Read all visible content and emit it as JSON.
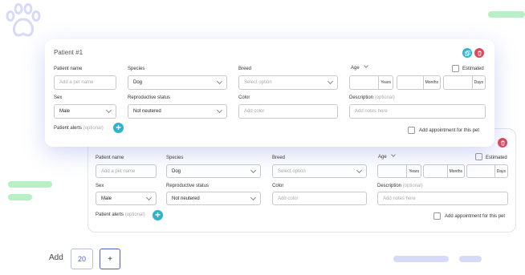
{
  "colors": {
    "brand_blue": "#4f5fc6",
    "teal": "#2fb2cf",
    "delete_red": "#e0485a",
    "deco_green": "#b6f0c4",
    "deco_lavender": "#d6daf8"
  },
  "icons": {
    "paw": "paw-icon",
    "copy": "copy-icon",
    "delete": "trash-icon",
    "add": "plus-icon",
    "dropdown": "chevron-down-icon"
  },
  "patient_card": {
    "title": "Patient #1",
    "labels": {
      "patient_name": "Patient name",
      "species": "Species",
      "breed": "Breed",
      "age": "Age",
      "estimated": "Estimated",
      "sex": "Sex",
      "reproductive_status": "Reproductive status",
      "color": "Color",
      "description": "Description",
      "description_optional": "(optional)",
      "patient_alerts": "Patient alerts",
      "patient_alerts_optional": "(optional)",
      "add_appointment": "Add appointment for this pet"
    },
    "fields": {
      "patient_name_placeholder": "Add a pet name",
      "species_value": "Dog",
      "breed_placeholder": "Select option",
      "age_years_unit": "Years",
      "age_months_unit": "Months",
      "age_days_unit": "Days",
      "sex_value": "Male",
      "reproductive_status_value": "Not neutered",
      "color_placeholder": "Add color",
      "description_placeholder": "Add notes here"
    }
  },
  "background_card": {
    "labels": {
      "patient_name": "Patient name",
      "species": "Species",
      "breed": "Breed",
      "age": "Age",
      "estimated": "Estimated",
      "sex": "Sex",
      "reproductive_status": "Reproductive status",
      "color": "Color",
      "description": "Description",
      "description_optional": "(optional)",
      "patient_alerts": "Patient alerts",
      "patient_alerts_optional": "(optional)",
      "add_appointment": "Add appointment for this pet"
    },
    "fields": {
      "patient_name_placeholder": "Add a pet name",
      "species_value": "Dog",
      "breed_placeholder": "Select option",
      "age_years_unit": "Years",
      "age_months_unit": "Months",
      "age_days_unit": "Days",
      "sex_value": "Male",
      "reproductive_status_value": "Not neutered",
      "color_placeholder": "Add color",
      "description_placeholder": "Add notes here"
    }
  },
  "footer": {
    "add_label": "Add",
    "count_value": "20",
    "plus_label": "+"
  }
}
